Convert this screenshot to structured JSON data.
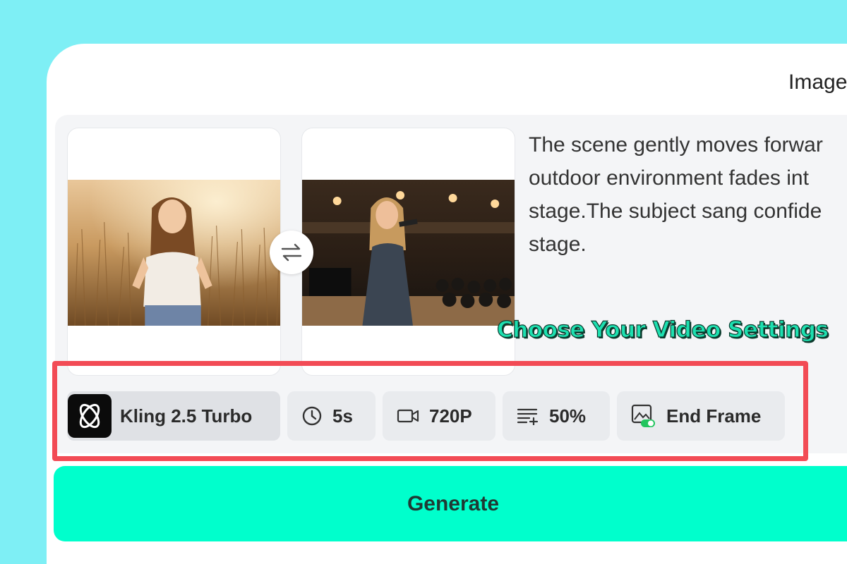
{
  "header": {
    "mode_label": "Image"
  },
  "frames": {
    "start": {
      "alt": "start frame photo"
    },
    "end": {
      "alt": "end frame photo"
    }
  },
  "prompt": {
    "text": "The scene gently moves forwar\noutdoor environment fades int\nstage.The subject sang confide\nstage."
  },
  "callout": {
    "text": "Choose Your Video Settings"
  },
  "settings": {
    "model": {
      "label": "Kling 2.5 Turbo",
      "icon": "kling-logo-icon"
    },
    "duration": {
      "label": "5s",
      "icon": "clock-icon"
    },
    "resolution": {
      "label": "720P",
      "icon": "video-camera-icon"
    },
    "strength": {
      "label": "50%",
      "icon": "list-adjust-icon"
    },
    "end_frame": {
      "label": "End Frame",
      "icon": "image-toggle-icon"
    }
  },
  "generate": {
    "label": "Generate"
  },
  "colors": {
    "background": "#7eeff5",
    "accent": "#00ffcc",
    "highlight_border": "#f24b55",
    "callout_text": "#1de0b0"
  }
}
